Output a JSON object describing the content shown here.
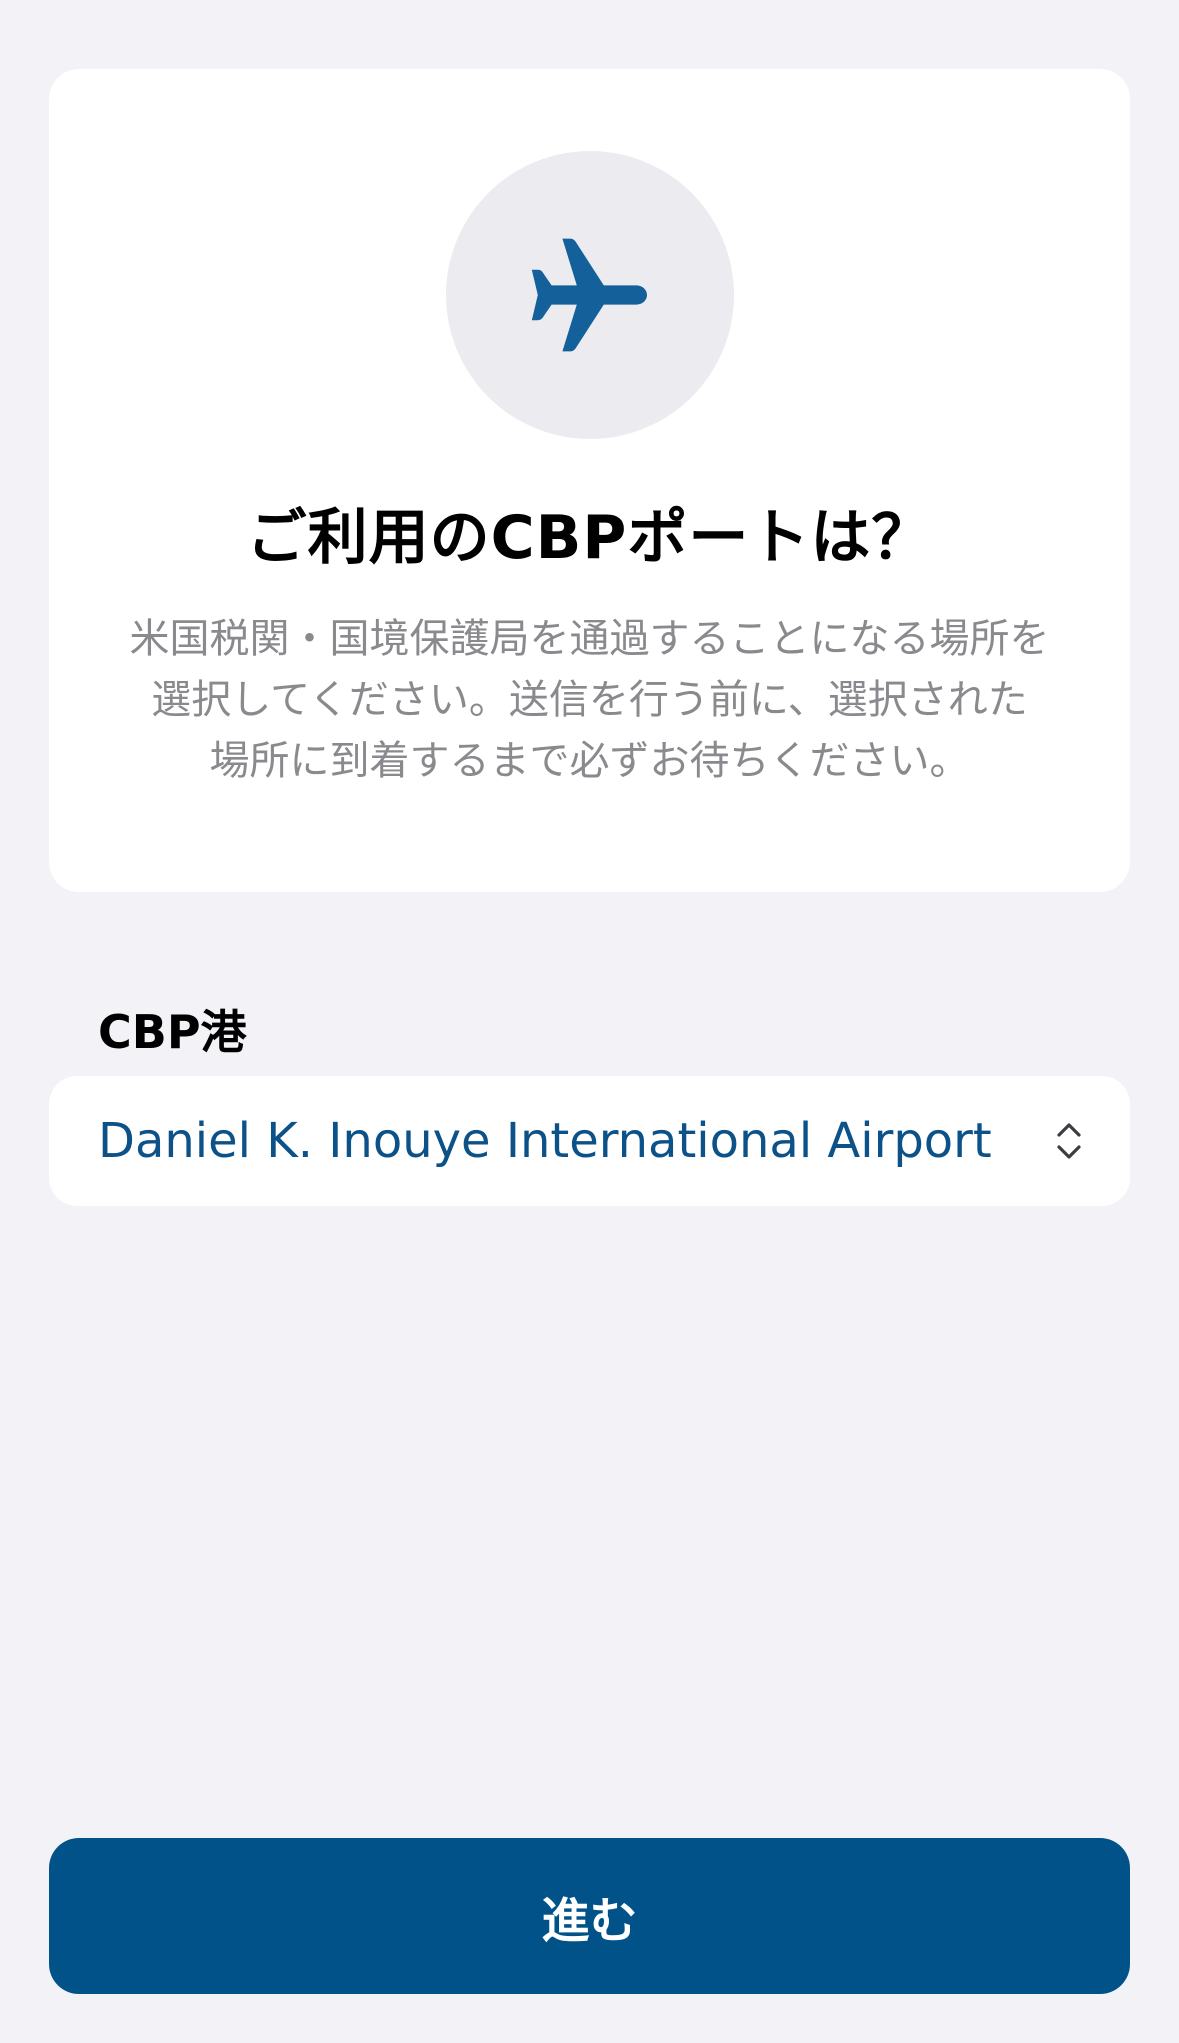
{
  "card": {
    "icon": "airplane-icon",
    "title": "ご利用のCBPポートは？",
    "description_lines": [
      "米国税関・国境保護局を通過することになる場所を",
      "選択してください。送信を行う前に、選択された",
      "場所に到着するまで必ずお待ちください。"
    ]
  },
  "port_section": {
    "label": "CBP港",
    "selected_value": "Daniel K. Inouye International Airport",
    "picker_icon": "chevron-up-down-icon"
  },
  "actions": {
    "continue_label": "進む"
  },
  "colors": {
    "background": "#f2f2f7",
    "card": "#ffffff",
    "accent": "#02528a",
    "link_text": "#0c5289",
    "secondary_text": "#8a8a8e",
    "icon_circle": "#ececf0"
  }
}
